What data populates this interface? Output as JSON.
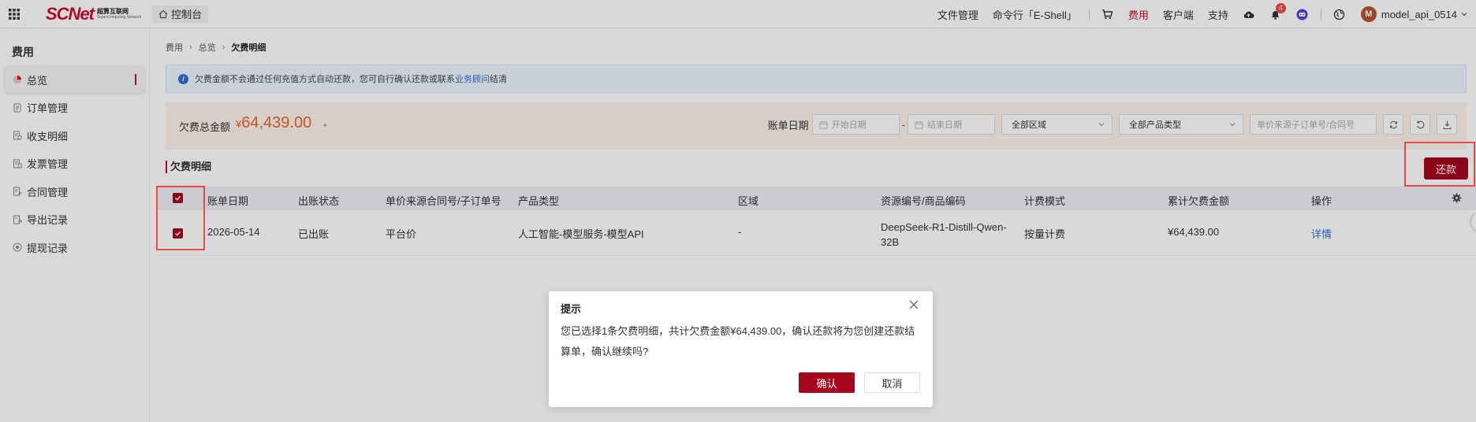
{
  "topbar": {
    "logo_text": "SCNet",
    "logo_sub_line1": "超算互联网",
    "logo_sub_line2": "Supercomputing Network",
    "console_label": "控制台",
    "nav": {
      "files": "文件管理",
      "eshell": "命令行「E-Shell」",
      "cost": "费用",
      "client": "客户端",
      "support": "支持"
    },
    "notification_count": "4",
    "avatar_letter": "M",
    "username": "model_api_0514"
  },
  "sidebar": {
    "title": "费用",
    "items": [
      {
        "label": "总览",
        "icon": "pie-chart-icon"
      },
      {
        "label": "订单管理",
        "icon": "order-icon"
      },
      {
        "label": "收支明细",
        "icon": "ledger-icon"
      },
      {
        "label": "发票管理",
        "icon": "invoice-icon"
      },
      {
        "label": "合同管理",
        "icon": "contract-icon"
      },
      {
        "label": "导出记录",
        "icon": "export-icon"
      },
      {
        "label": "提现记录",
        "icon": "withdraw-icon"
      }
    ]
  },
  "breadcrumb": [
    "费用",
    "总览",
    "欠费明细"
  ],
  "notice": {
    "text_before": "欠费金额不会通过任何充值方式自动还款，您可自行确认还款或联系",
    "link": "业务顾问",
    "text_after": "结清"
  },
  "summary": {
    "label": "欠费总金额",
    "currency": "¥",
    "amount": "64,439.00"
  },
  "filters": {
    "date_label": "账单日期",
    "start_placeholder": "开始日期",
    "end_placeholder": "结束日期",
    "dash": "-",
    "region": "全部区域",
    "product_type": "全部产品类型",
    "search_placeholder": "单价来源子订单号/合同号"
  },
  "section_title": "欠费明细",
  "repay_button": "还款",
  "table": {
    "headers": [
      "账单日期",
      "出账状态",
      "单价来源合同号/子订单号",
      "产品类型",
      "区域",
      "资源编号/商品编码",
      "计费模式",
      "累计欠费金额",
      "操作"
    ],
    "rows": [
      {
        "date": "2026-05-14",
        "status": "已出账",
        "source": "平台价",
        "product": "人工智能-模型服务-模型API",
        "region": "-",
        "resource": "DeepSeek-R1-Distill-Qwen-32B",
        "billing": "按量计费",
        "amount": "¥64,439.00",
        "action": "详情"
      }
    ]
  },
  "modal": {
    "title": "提示",
    "body": "您已选择1条欠费明细，共计欠费金额¥64,439.00，确认还款将为您创建还款结算单，确认继续吗?",
    "confirm": "确认",
    "cancel": "取消"
  },
  "colors": {
    "brand_red": "#a5071f",
    "amount_orange": "#e8652c",
    "link_blue": "#2f6fd8",
    "highlight_red": "#e84a4a"
  }
}
